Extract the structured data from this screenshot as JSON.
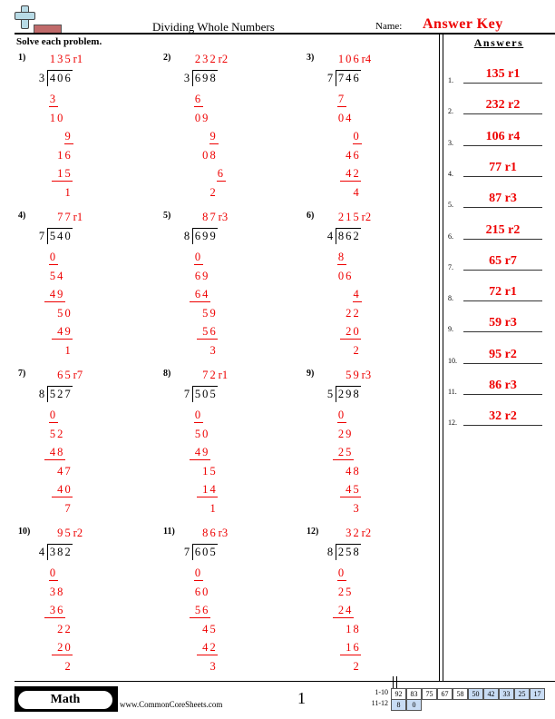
{
  "header": {
    "title": "Dividing Whole Numbers",
    "name_label": "Name:",
    "name_value": "Answer Key",
    "logo_icon": "plus-ruler-logo-icon"
  },
  "instructions": "Solve each problem.",
  "answers_panel": {
    "heading": "Answers",
    "items": [
      {
        "num": "1.",
        "value": "135 r1"
      },
      {
        "num": "2.",
        "value": "232 r2"
      },
      {
        "num": "3.",
        "value": "106 r4"
      },
      {
        "num": "4.",
        "value": "77 r1"
      },
      {
        "num": "5.",
        "value": "87 r3"
      },
      {
        "num": "6.",
        "value": "215 r2"
      },
      {
        "num": "7.",
        "value": "65 r7"
      },
      {
        "num": "8.",
        "value": "72 r1"
      },
      {
        "num": "9.",
        "value": "59 r3"
      },
      {
        "num": "10.",
        "value": "95 r2"
      },
      {
        "num": "11.",
        "value": "86 r3"
      },
      {
        "num": "12.",
        "value": "32 r2"
      }
    ]
  },
  "problems": [
    {
      "label": "1)",
      "divisor": "3",
      "dividend": "406",
      "quotient": "135",
      "remainder": "r1",
      "steps": [
        [
          "3",
          0
        ],
        [
          "10",
          0
        ],
        [
          "9",
          1
        ],
        [
          "16",
          1
        ],
        [
          "15",
          1
        ],
        [
          "1",
          2
        ]
      ]
    },
    {
      "label": "2)",
      "divisor": "3",
      "dividend": "698",
      "quotient": "232",
      "remainder": "r2",
      "steps": [
        [
          "6",
          0
        ],
        [
          "09",
          0
        ],
        [
          "9",
          1
        ],
        [
          "08",
          1
        ],
        [
          "6",
          2
        ],
        [
          "2",
          2
        ]
      ]
    },
    {
      "label": "3)",
      "divisor": "7",
      "dividend": "746",
      "quotient": "106",
      "remainder": "r4",
      "steps": [
        [
          "7",
          0
        ],
        [
          "04",
          0
        ],
        [
          "0",
          1
        ],
        [
          "46",
          1
        ],
        [
          "42",
          1
        ],
        [
          "4",
          2
        ]
      ]
    },
    {
      "label": "4)",
      "divisor": "7",
      "dividend": "540",
      "quotient": "77",
      "remainder": "r1",
      "steps": [
        [
          "0",
          0
        ],
        [
          "54",
          0
        ],
        [
          "49",
          0
        ],
        [
          "50",
          1
        ],
        [
          "49",
          1
        ],
        [
          "1",
          2
        ]
      ]
    },
    {
      "label": "5)",
      "divisor": "8",
      "dividend": "699",
      "quotient": "87",
      "remainder": "r3",
      "steps": [
        [
          "0",
          0
        ],
        [
          "69",
          0
        ],
        [
          "64",
          0
        ],
        [
          "59",
          1
        ],
        [
          "56",
          1
        ],
        [
          "3",
          2
        ]
      ]
    },
    {
      "label": "6)",
      "divisor": "4",
      "dividend": "862",
      "quotient": "215",
      "remainder": "r2",
      "steps": [
        [
          "8",
          0
        ],
        [
          "06",
          0
        ],
        [
          "4",
          1
        ],
        [
          "22",
          1
        ],
        [
          "20",
          1
        ],
        [
          "2",
          2
        ]
      ]
    },
    {
      "label": "7)",
      "divisor": "8",
      "dividend": "527",
      "quotient": "65",
      "remainder": "r7",
      "steps": [
        [
          "0",
          0
        ],
        [
          "52",
          0
        ],
        [
          "48",
          0
        ],
        [
          "47",
          1
        ],
        [
          "40",
          1
        ],
        [
          "7",
          2
        ]
      ]
    },
    {
      "label": "8)",
      "divisor": "7",
      "dividend": "505",
      "quotient": "72",
      "remainder": "r1",
      "steps": [
        [
          "0",
          0
        ],
        [
          "50",
          0
        ],
        [
          "49",
          0
        ],
        [
          "15",
          1
        ],
        [
          "14",
          1
        ],
        [
          "1",
          2
        ]
      ]
    },
    {
      "label": "9)",
      "divisor": "5",
      "dividend": "298",
      "quotient": "59",
      "remainder": "r3",
      "steps": [
        [
          "0",
          0
        ],
        [
          "29",
          0
        ],
        [
          "25",
          0
        ],
        [
          "48",
          1
        ],
        [
          "45",
          1
        ],
        [
          "3",
          2
        ]
      ]
    },
    {
      "label": "10)",
      "divisor": "4",
      "dividend": "382",
      "quotient": "95",
      "remainder": "r2",
      "steps": [
        [
          "0",
          0
        ],
        [
          "38",
          0
        ],
        [
          "36",
          0
        ],
        [
          "22",
          1
        ],
        [
          "20",
          1
        ],
        [
          "2",
          2
        ]
      ]
    },
    {
      "label": "11)",
      "divisor": "7",
      "dividend": "605",
      "quotient": "86",
      "remainder": "r3",
      "steps": [
        [
          "0",
          0
        ],
        [
          "60",
          0
        ],
        [
          "56",
          0
        ],
        [
          "45",
          1
        ],
        [
          "42",
          1
        ],
        [
          "3",
          2
        ]
      ]
    },
    {
      "label": "12)",
      "divisor": "8",
      "dividend": "258",
      "quotient": "32",
      "remainder": "r2",
      "steps": [
        [
          "0",
          0
        ],
        [
          "25",
          0
        ],
        [
          "24",
          0
        ],
        [
          "18",
          1
        ],
        [
          "16",
          1
        ],
        [
          "2",
          2
        ]
      ]
    }
  ],
  "footer": {
    "subject": "Math",
    "website": "www.CommonCoreSheets.com",
    "page": "1",
    "score_rows": [
      {
        "label": "1-10",
        "cells": [
          "92",
          "83",
          "75",
          "67",
          "58",
          "50",
          "42",
          "33",
          "25",
          "17"
        ],
        "highlight_from": 5
      },
      {
        "label": "11-12",
        "cells": [
          "8",
          "0"
        ],
        "highlight_from": 0
      }
    ]
  }
}
